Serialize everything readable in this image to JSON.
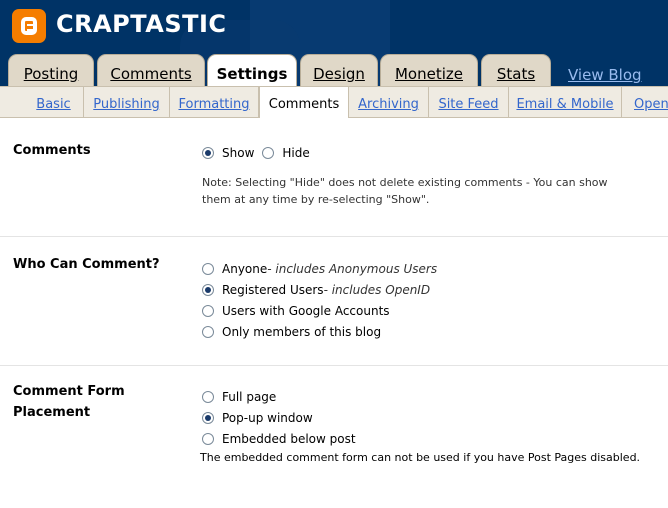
{
  "header": {
    "blog_title": "CRAPTASTIC",
    "view_blog": "View Blog"
  },
  "tabs": [
    "Posting",
    "Comments",
    "Settings",
    "Design",
    "Monetize",
    "Stats"
  ],
  "subtabs": [
    "Basic",
    "Publishing",
    "Formatting",
    "Comments",
    "Archiving",
    "Site Feed",
    "Email & Mobile",
    "OpenID"
  ],
  "comments": {
    "label": "Comments",
    "show": "Show",
    "hide": "Hide",
    "note": "Note: Selecting \"Hide\" does not delete existing comments - You can show them at any time by re-selecting \"Show\"."
  },
  "who": {
    "label": "Who Can Comment?",
    "opt1": "Anyone",
    "opt1_desc": " - includes Anonymous Users",
    "opt2": "Registered Users",
    "opt2_desc": " - includes OpenID",
    "opt3": "Users with Google Accounts",
    "opt4": "Only members of this blog"
  },
  "placement": {
    "label_line1": "Comment Form",
    "label_line2": "Placement",
    "opt1": "Full page",
    "opt2": "Pop-up window",
    "opt3": "Embedded below post",
    "note": "The embedded comment form can not be used if you have Post Pages disabled."
  }
}
